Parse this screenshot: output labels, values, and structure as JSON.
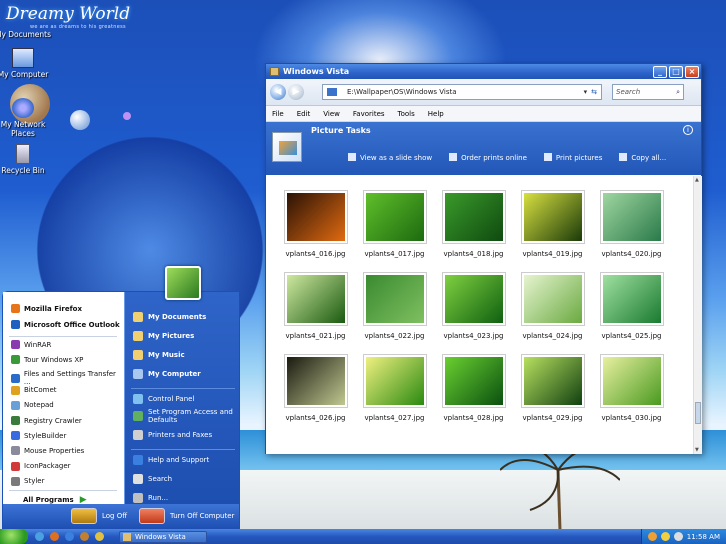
{
  "desktop": {
    "logo": "Dreamy World",
    "logo_subtitle": "we are as dreams to his greatness",
    "icons": [
      {
        "label": "My Documents"
      },
      {
        "label": "My Computer"
      },
      {
        "label": "My Network Places"
      },
      {
        "label": "Recycle Bin"
      }
    ]
  },
  "window": {
    "title": "Windows Vista",
    "address": "E:\\Wallpaper\\OS\\Windows Vista",
    "search_placeholder": "Search",
    "menu": [
      "File",
      "Edit",
      "View",
      "Favorites",
      "Tools",
      "Help"
    ],
    "task_title": "Picture Tasks",
    "tasks": [
      "View as a slide show",
      "Order prints online",
      "Print pictures",
      "Copy all..."
    ],
    "thumbnails": [
      {
        "name": "vplants4_016.jpg",
        "colors": [
          "#2a1206",
          "#e06a10"
        ]
      },
      {
        "name": "vplants4_017.jpg",
        "colors": [
          "#5fbf2a",
          "#1d6a10"
        ]
      },
      {
        "name": "vplants4_018.jpg",
        "colors": [
          "#3a9a2a",
          "#0f4a10"
        ]
      },
      {
        "name": "vplants4_019.jpg",
        "colors": [
          "#d8e040",
          "#1a3a0a"
        ]
      },
      {
        "name": "vplants4_020.jpg",
        "colors": [
          "#9fd6a0",
          "#2a7a4a"
        ]
      },
      {
        "name": "vplants4_021.jpg",
        "colors": [
          "#cfe8a0",
          "#1a5a10"
        ]
      },
      {
        "name": "vplants4_022.jpg",
        "colors": [
          "#3a8a30",
          "#7fc060"
        ]
      },
      {
        "name": "vplants4_023.jpg",
        "colors": [
          "#7fd040",
          "#0f6010"
        ]
      },
      {
        "name": "vplants4_024.jpg",
        "colors": [
          "#e6f4d0",
          "#6aaa40"
        ]
      },
      {
        "name": "vplants4_025.jpg",
        "colors": [
          "#9fe0a0",
          "#1a7a30"
        ]
      },
      {
        "name": "vplants4_026.jpg",
        "colors": [
          "#1a1a10",
          "#c0c890"
        ]
      },
      {
        "name": "vplants4_027.jpg",
        "colors": [
          "#f0f080",
          "#2a8a10"
        ]
      },
      {
        "name": "vplants4_028.jpg",
        "colors": [
          "#6ad030",
          "#0a5010"
        ]
      },
      {
        "name": "vplants4_029.jpg",
        "colors": [
          "#b8e060",
          "#104010"
        ]
      },
      {
        "name": "vplants4_030.jpg",
        "colors": [
          "#e8f0a0",
          "#4a9a20"
        ]
      }
    ]
  },
  "start_menu": {
    "pinned": [
      {
        "label": "Mozilla Firefox",
        "color": "#e8741a"
      },
      {
        "label": "Microsoft Office Outlook",
        "color": "#1f5fbf"
      }
    ],
    "recent": [
      {
        "label": "WinRAR",
        "color": "#8a3ab0"
      },
      {
        "label": "Tour Windows XP",
        "color": "#3a9a3a"
      },
      {
        "label": "Files and Settings Transfer ...",
        "color": "#2a6ac8"
      },
      {
        "label": "BitComet",
        "color": "#e0a020"
      },
      {
        "label": "Notepad",
        "color": "#6aa0d8"
      },
      {
        "label": "Registry Crawler",
        "color": "#3a7a3a"
      },
      {
        "label": "StyleBuilder",
        "color": "#3a6ae0"
      },
      {
        "label": "Mouse Properties",
        "color": "#8a8a9a"
      },
      {
        "label": "IconPackager",
        "color": "#d03a3a"
      },
      {
        "label": "Styler",
        "color": "#7a7a7a"
      }
    ],
    "all_programs": "All Programs",
    "right_top": [
      {
        "label": "My Documents",
        "color": "#f0d070"
      },
      {
        "label": "My Pictures",
        "color": "#f0d070"
      },
      {
        "label": "My Music",
        "color": "#f0d070"
      },
      {
        "label": "My Computer",
        "color": "#a8c8f0"
      }
    ],
    "right_mid": [
      {
        "label": "Control Panel",
        "color": "#80c0f0"
      },
      {
        "label": "Set Program Access and Defaults",
        "color": "#60b060"
      },
      {
        "label": "Printers and Faxes",
        "color": "#d0d0d0"
      }
    ],
    "right_bottom": [
      {
        "label": "Help and Support",
        "color": "#3a80e0"
      },
      {
        "label": "Search",
        "color": "#e0e0e0"
      },
      {
        "label": "Run...",
        "color": "#c0c0c0"
      }
    ],
    "log_off": "Log Off",
    "turn_off": "Turn Off Computer"
  },
  "taskbar": {
    "app": "Windows Vista",
    "time": "11:58 AM"
  }
}
